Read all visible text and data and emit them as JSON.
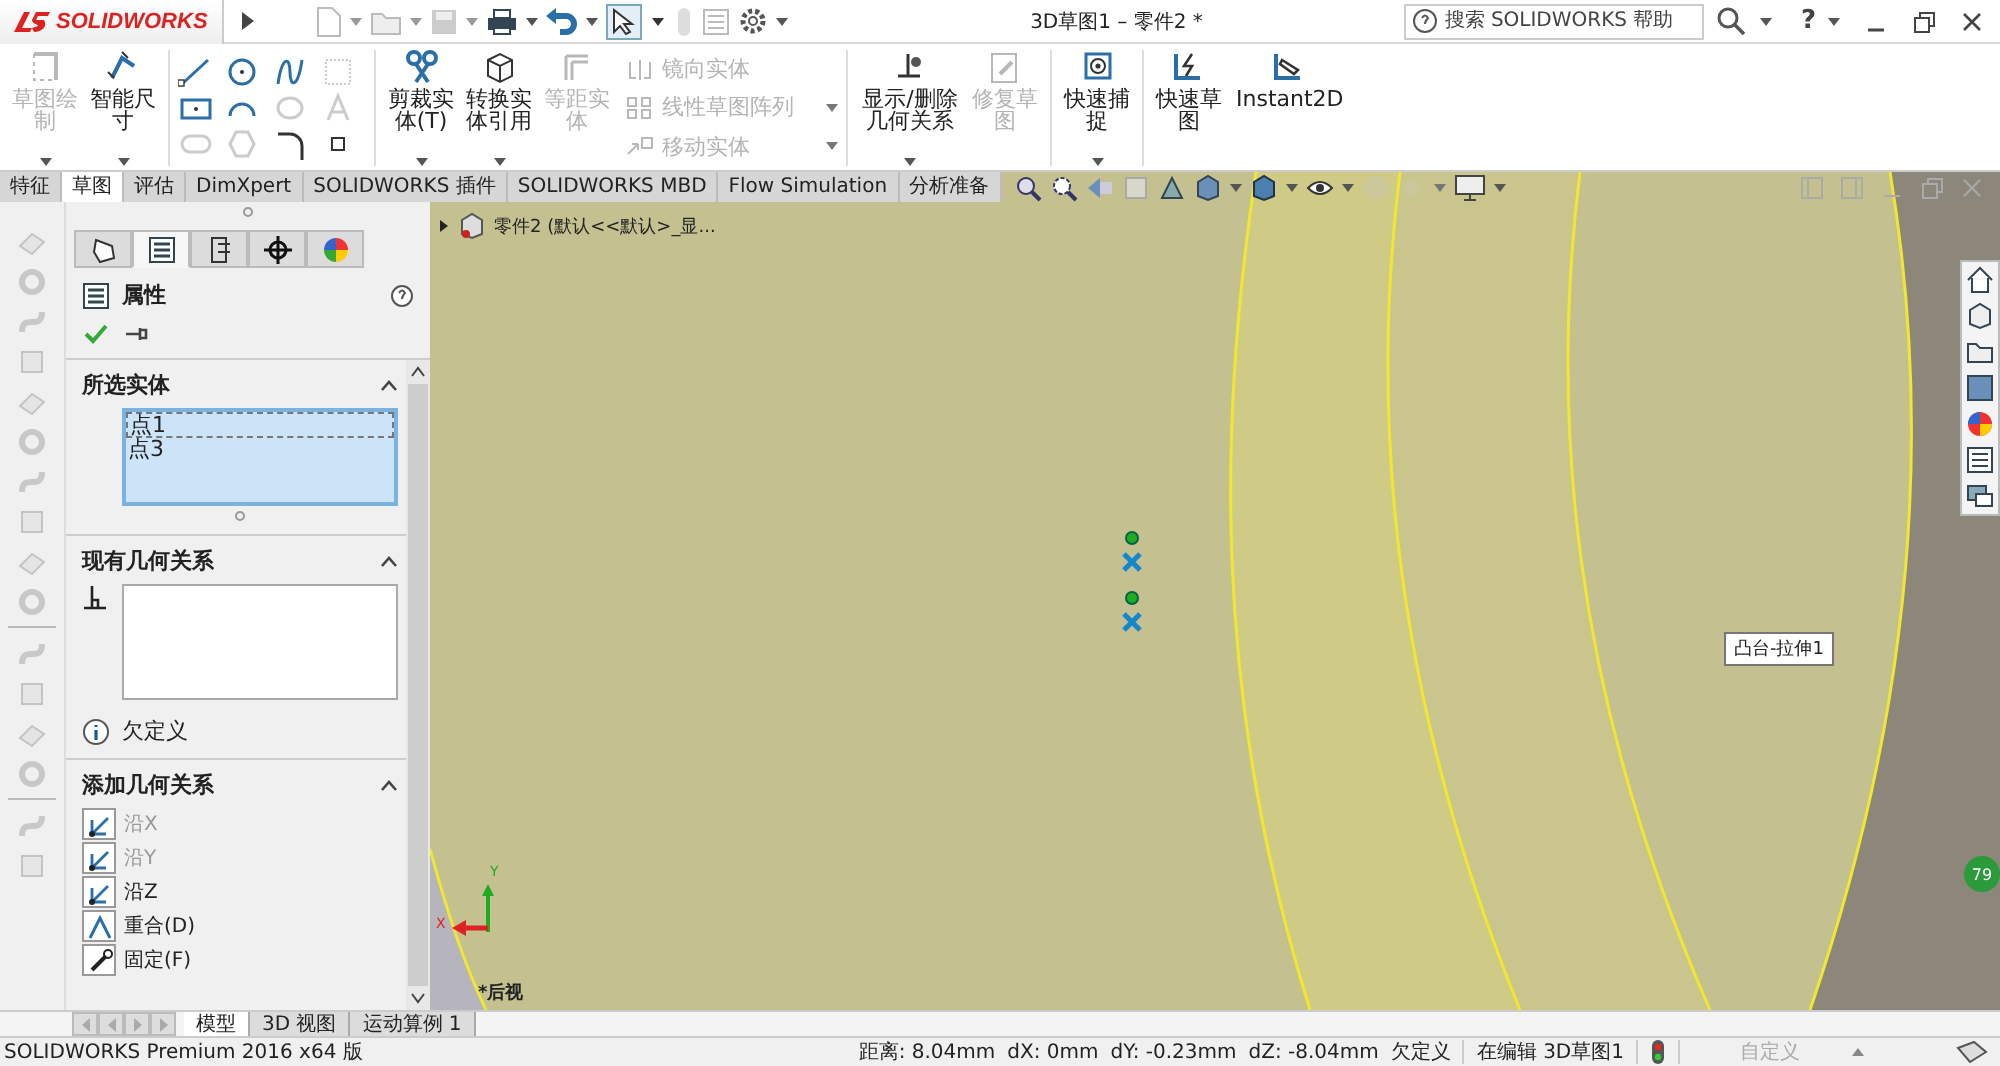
{
  "title_bar": {
    "logo": "SOLIDWORKS",
    "title": "3D草图1 – 零件2 *",
    "search": {
      "placeholder": "搜索 SOLIDWORKS 帮助"
    },
    "help": "?"
  },
  "ribbon": {
    "sketch_group": [
      {
        "label": "草图绘制",
        "disabled": true
      },
      {
        "label": "智能尺寸",
        "disabled": false
      }
    ],
    "edit_group": [
      {
        "label": "剪裁实体(T)",
        "disabled": false
      },
      {
        "label": "转换实体引用",
        "disabled": false
      },
      {
        "label": "等距实体",
        "disabled": true
      }
    ],
    "list_group": [
      {
        "label": "镜向实体",
        "disabled": true
      },
      {
        "label": "线性草图阵列",
        "disabled": true
      },
      {
        "label": "移动实体",
        "disabled": true
      }
    ],
    "relations_group": [
      {
        "label": "显示/删除几何关系",
        "disabled": false
      },
      {
        "label": "修复草图",
        "disabled": true
      }
    ],
    "snap_group": [
      {
        "label": "快速捕捉",
        "disabled": false
      }
    ],
    "instant_group": [
      {
        "label": "快速草图",
        "disabled": false
      },
      {
        "label": "Instant2D",
        "disabled": false
      }
    ]
  },
  "command_tabs": [
    {
      "label": "特征",
      "selected": false
    },
    {
      "label": "草图",
      "selected": true
    },
    {
      "label": "评估",
      "selected": false
    },
    {
      "label": "DimXpert",
      "selected": false
    },
    {
      "label": "SOLIDWORKS 插件",
      "selected": false
    },
    {
      "label": "SOLIDWORKS MBD",
      "selected": false
    },
    {
      "label": "Flow Simulation",
      "selected": false
    },
    {
      "label": "分析准备",
      "selected": false
    }
  ],
  "property_manager": {
    "panel_tabs": [
      {
        "selected": false
      },
      {
        "selected": true
      },
      {
        "selected": false
      },
      {
        "selected": false
      },
      {
        "selected": false
      }
    ],
    "title": "属性",
    "selected_entities": {
      "heading": "所选实体",
      "items": [
        {
          "label": "点1",
          "selected": true
        },
        {
          "label": "点3",
          "selected": false
        }
      ]
    },
    "existing_relations": {
      "heading": "现有几何关系",
      "status": "欠定义"
    },
    "add_relations": {
      "heading": "添加几何关系",
      "items": [
        {
          "label": "沿X",
          "disabled": true
        },
        {
          "label": "沿Y",
          "disabled": true
        },
        {
          "label": "沿Z",
          "disabled": false
        },
        {
          "label": "重合(D)",
          "disabled": false
        },
        {
          "label": "固定(F)",
          "disabled": false
        }
      ]
    }
  },
  "graphics": {
    "feature_tree": "零件2 (默认<<默认>_显...",
    "tooltip": "凸台-拉伸1",
    "triad": {
      "x": "X",
      "y": "Y"
    },
    "view_name": "*后视",
    "badge": "79"
  },
  "bottom_tabs": [
    {
      "label": "模型",
      "selected": true
    },
    {
      "label": "3D 视图",
      "selected": false
    },
    {
      "label": "运动算例 1",
      "selected": false
    }
  ],
  "status_bar": {
    "product": "SOLIDWORKS Premium 2016 x64 版",
    "readouts": [
      "距离: 8.04mm",
      "dX: 0mm",
      "dY: -0.23mm",
      "dZ: -8.04mm"
    ],
    "state": "欠定义",
    "editing": "在编辑 3D草图1",
    "units": "自定义"
  }
}
